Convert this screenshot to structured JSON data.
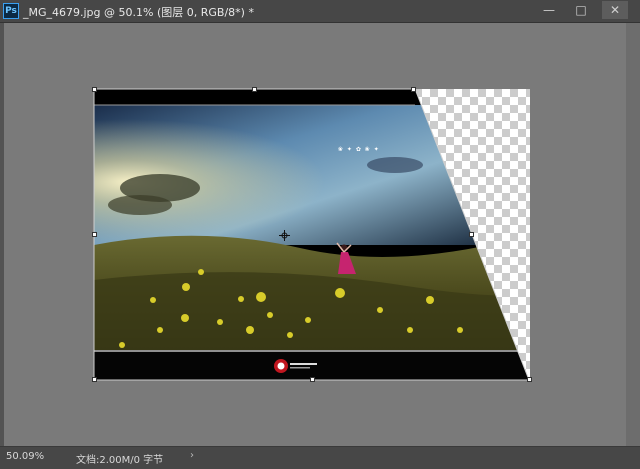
{
  "window": {
    "app_icon": "Ps",
    "title": "_MG_4679.jpg @ 50.1% (图层 0, RGB/8*) *",
    "controls": [
      "minimize-icon",
      "restore-icon",
      "close-icon"
    ]
  },
  "status": {
    "zoom": "50.09%",
    "doc_info": "文档:2.00M/0 字节",
    "arrow": "›"
  },
  "canvas": {
    "checkerboard_light": "#ffffff",
    "checkerboard_dark": "#cccccc",
    "pasteboard_color": "#7a7a7a",
    "caption_art": "❀ ✦ ✿ ❀ ✦"
  },
  "colors": {
    "ui_dark": "#474747",
    "ui_frame": "#535353"
  }
}
